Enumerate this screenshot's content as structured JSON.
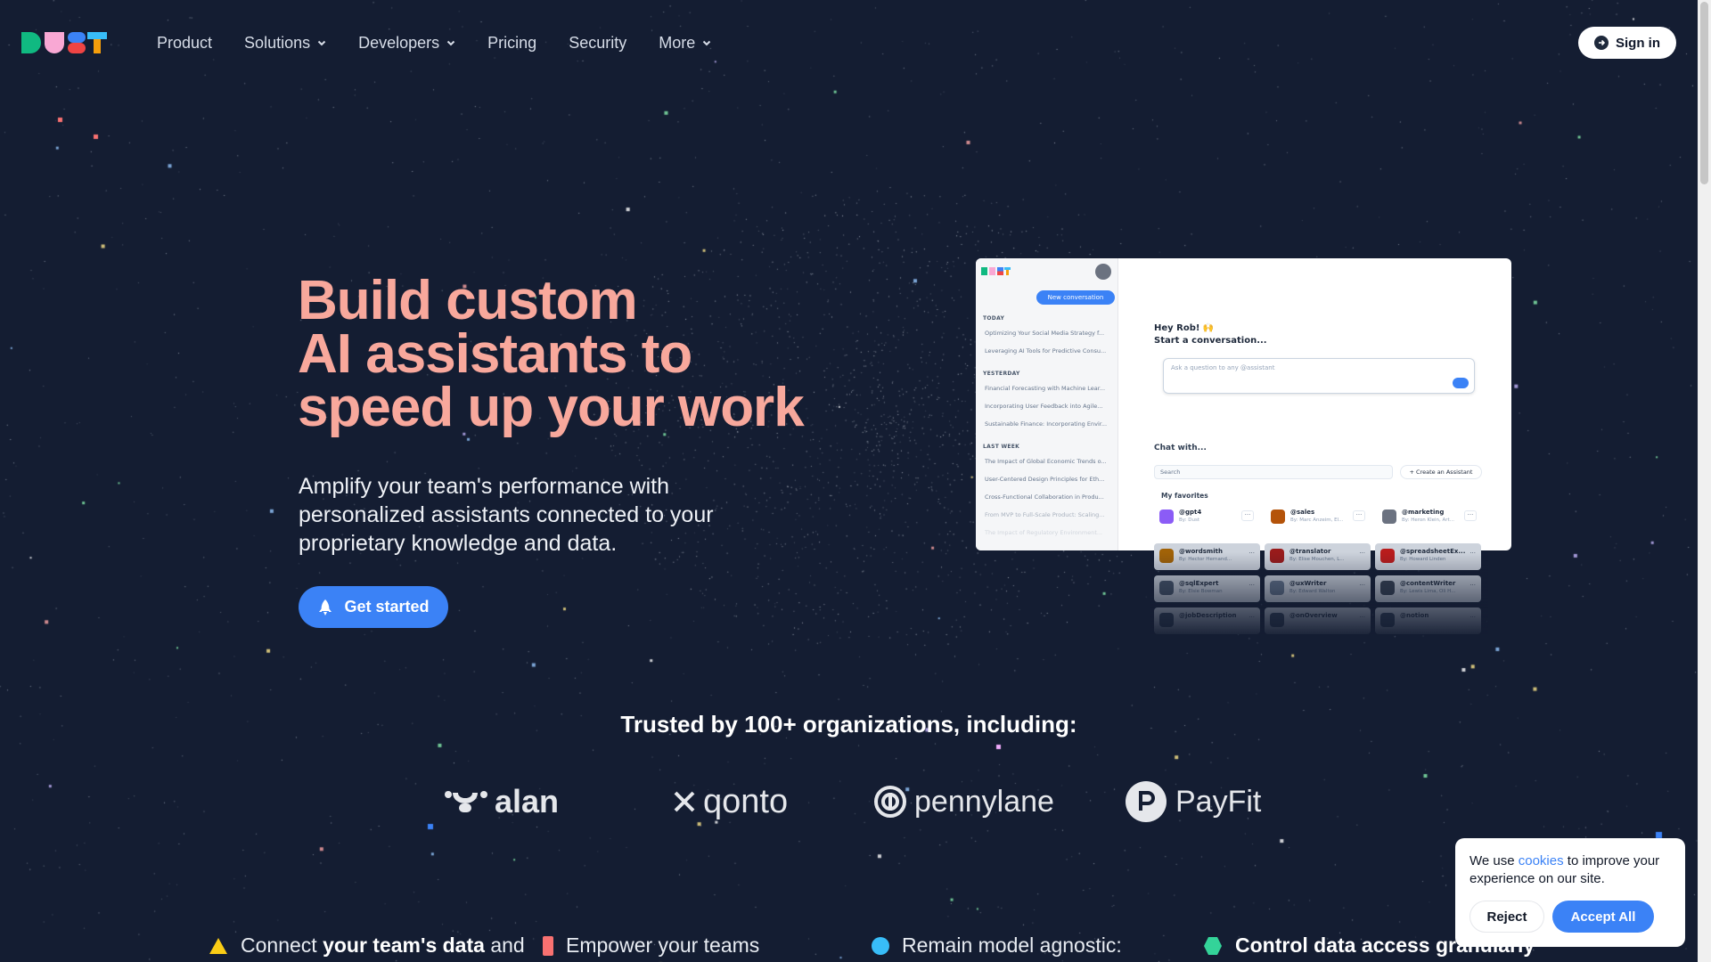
{
  "nav": {
    "items": [
      {
        "label": "Product",
        "dropdown": false
      },
      {
        "label": "Solutions",
        "dropdown": true
      },
      {
        "label": "Developers",
        "dropdown": true
      },
      {
        "label": "Pricing",
        "dropdown": false
      },
      {
        "label": "Security",
        "dropdown": false
      },
      {
        "label": "More",
        "dropdown": true
      }
    ],
    "signin_label": "Sign in"
  },
  "hero": {
    "title_lines": [
      "Build custom",
      "AI assistants to",
      "speed up your work"
    ],
    "subtitle": "Amplify your team's performance with personalized assistants connected to your proprietary knowledge and data.",
    "cta_label": "Get started"
  },
  "preview": {
    "new_conversation": "New conversation",
    "sections": [
      {
        "title": "TODAY",
        "items": [
          "Optimizing Your Social Media Strategy f...",
          "Leveraging AI Tools for Predictive Consu..."
        ]
      },
      {
        "title": "YESTERDAY",
        "items": [
          "Financial Forecasting with Machine Lear...",
          "Incorporating User Feedback into Agile...",
          "Sustainable Finance: Incorporating Envir..."
        ]
      },
      {
        "title": "LAST WEEK",
        "items": [
          "The Impact of Global Economic Trends o...",
          "User-Centered Design Principles for Eth...",
          "Cross-Functional Collaboration in Produ...",
          "From MVP to Full-Scale Product: Scaling...",
          "The Impact of Regulatory Environment..."
        ]
      }
    ],
    "greeting": "Hey Rob! 🙌",
    "start": "Start a conversation...",
    "ask_placeholder": "Ask a question to any @assistant",
    "chat_with": "Chat with...",
    "search_placeholder": "Search",
    "create_assistant": "Create an Assistant",
    "favorites_title": "My favorites",
    "favorites": [
      {
        "name": "@gpt4",
        "by": "By: Dust",
        "color": "#8b5cf6"
      },
      {
        "name": "@sales",
        "by": "By: Marc Anzeim, El...",
        "color": "#b45309"
      },
      {
        "name": "@marketing",
        "by": "By: Heron Klein, Art...",
        "color": "#6b7280"
      }
    ],
    "ghost_agents": [
      {
        "name": "@wordsmith",
        "by": "By: Hector Hernand...",
        "color": "#a16207"
      },
      {
        "name": "@translator",
        "by": "By: Elise Mouchen, L...",
        "color": "#991b1b"
      },
      {
        "name": "@spreadsheetEx...",
        "by": "By: Howard Linden",
        "color": "#b91c1c"
      },
      {
        "name": "@sqlExpert",
        "by": "By: Elsie Bowman",
        "color": "#475569"
      },
      {
        "name": "@uxWriter",
        "by": "By: Edward Walton",
        "color": "#64748b"
      },
      {
        "name": "@contentWriter",
        "by": "By: Lewis Lima, Oli H...",
        "color": "#374151"
      },
      {
        "name": "@jobDescription",
        "by": "",
        "color": "#334155"
      },
      {
        "name": "@onOverview",
        "by": "",
        "color": "#334155"
      },
      {
        "name": "@notion",
        "by": "",
        "color": "#334155"
      }
    ]
  },
  "trusted": {
    "heading": "Trusted by 100+ organizations, including:",
    "brands": [
      "alan",
      "qonto",
      "pennylane",
      "PayFit"
    ]
  },
  "features": [
    {
      "pre": "Connect ",
      "bold": "your team's data",
      "post": " and",
      "color": "#facc15",
      "shape": "triangle"
    },
    {
      "pre": "Empower your teams",
      "bold": "",
      "post": "",
      "color": "#f87171",
      "shape": "bar"
    },
    {
      "pre": "Remain model agnostic:",
      "bold": "",
      "post": "",
      "color": "#38bdf8",
      "shape": "circle"
    },
    {
      "pre": "",
      "bold": "Control data access granularly",
      "post": "",
      "color": "#34d399",
      "shape": "hexagon"
    }
  ],
  "cookie": {
    "text_pre": "We use ",
    "link": "cookies",
    "text_post": " to improve your experience on our site.",
    "reject_label": "Reject",
    "accept_label": "Accept All"
  },
  "colors": {
    "background": "#141d32",
    "accent": "#3b82f6",
    "hero_title": "#f8a89c"
  }
}
